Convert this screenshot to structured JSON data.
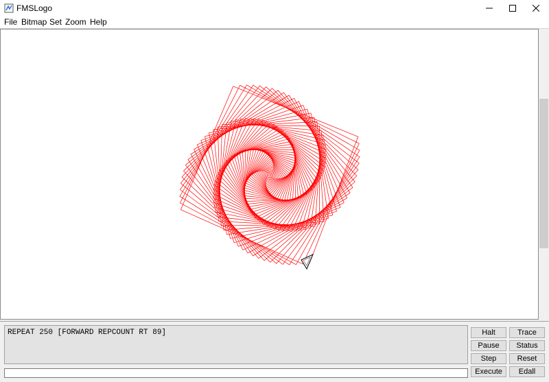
{
  "window": {
    "title": "FMSLogo",
    "controls": {
      "minimize_icon": "minimize-icon",
      "maximize_icon": "maximize-icon",
      "close_icon": "close-icon"
    }
  },
  "menu": [
    {
      "label": "File"
    },
    {
      "label": "Bitmap"
    },
    {
      "label": "Set"
    },
    {
      "label": "Zoom"
    },
    {
      "label": "Help"
    }
  ],
  "canvas": {
    "pen_color": "#ff0000",
    "drawing": "square-spiral",
    "turtle_icon": "turtle-triangle-icon"
  },
  "commander": {
    "history_text": "REPEAT 250 [FORWARD REPCOUNT RT 89]",
    "input_value": "",
    "buttons": {
      "halt": "Halt",
      "trace": "Trace",
      "pause": "Pause",
      "status": "Status",
      "step": "Step",
      "reset": "Reset",
      "execute": "Execute",
      "edall": "Edall"
    }
  }
}
